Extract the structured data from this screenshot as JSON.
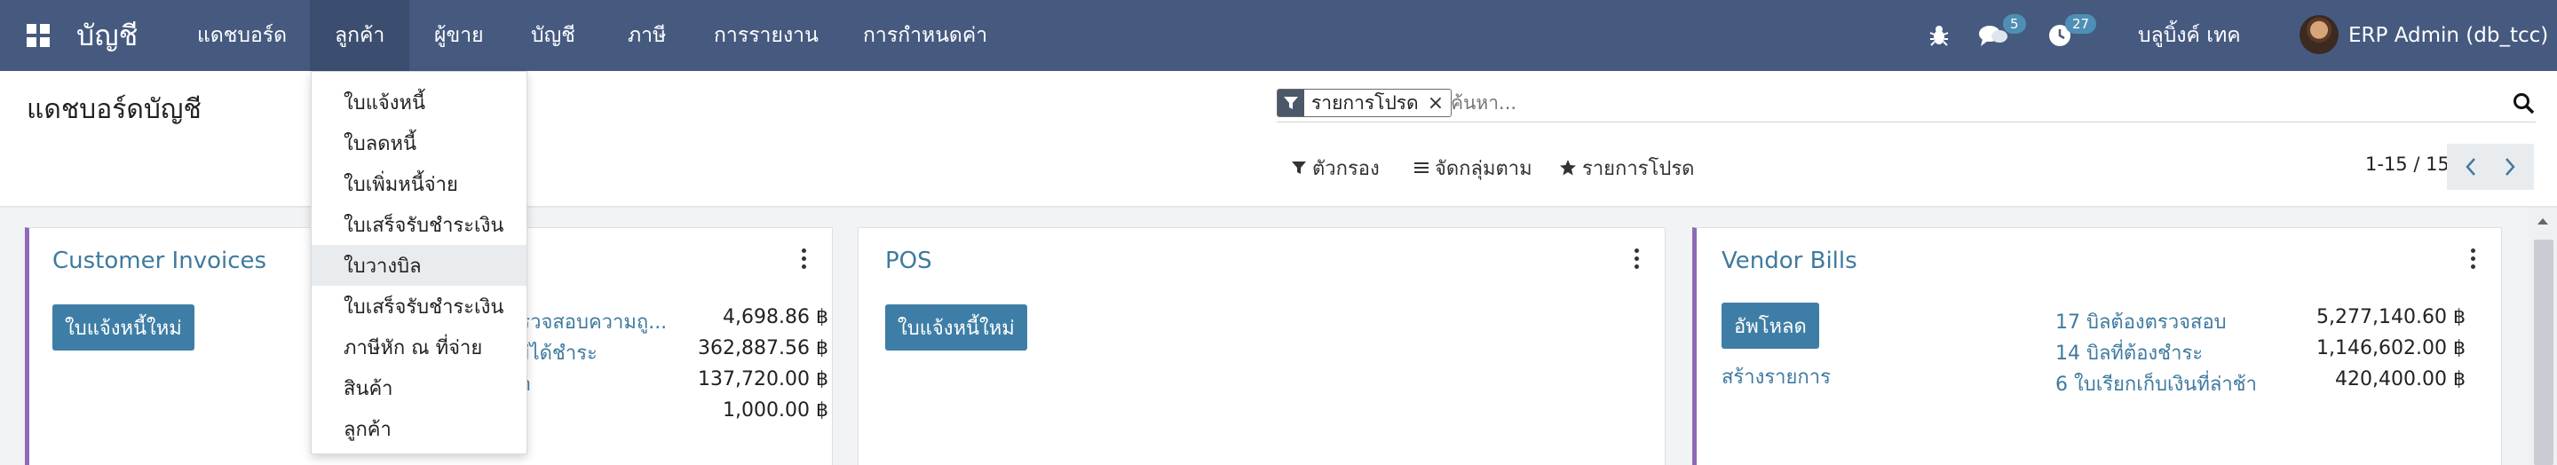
{
  "navbar": {
    "brand": "บัญชี",
    "menus": [
      "แดชบอร์ด",
      "ลูกค้า",
      "ผู้ขาย",
      "บัญชี",
      "ภาษี",
      "การรายงาน",
      "การกำหนดค่า"
    ],
    "active_menu": "ลูกค้า",
    "messages_count": "5",
    "activities_count": "27",
    "company": "บลูบิ้งค์ เทค",
    "user": "ERP Admin (db_tcc)"
  },
  "dropdown": {
    "items": [
      "ใบแจ้งหนี้",
      "ใบลดหนี้",
      "ใบเพิ่มหนี้จ่าย",
      "ใบเสร็จรับชำระเงิน",
      "ใบวางบิล",
      "ใบเสร็จรับชำระเงิน",
      "ภาษีหัก ณ ที่จ่าย",
      "สินค้า",
      "ลูกค้า"
    ],
    "hovered": "ใบวางบิล"
  },
  "control_panel": {
    "title": "แดชบอร์ดบัญชี",
    "facet": "รายการโปรด",
    "search_placeholder": "ค้นหา...",
    "filters_label": "ตัวกรอง",
    "group_by_label": "จัดกลุ่มตาม",
    "favorites_label": "รายการโปรด",
    "pager": "1-15 / 15"
  },
  "cards": {
    "customer_invoices": {
      "title": "Customer Invoices",
      "button": "ใบแจ้งหนี้ใหม่",
      "rows": [
        {
          "label": "ตรวจสอบความถู...",
          "amount": "4,698.86 ฿"
        },
        {
          "label": "ไม่ได้ชำระ",
          "amount": "362,887.56 ฿"
        },
        {
          "label": "ช้า",
          "amount": "137,720.00 ฿"
        },
        {
          "label": "",
          "amount": "1,000.00 ฿"
        }
      ]
    },
    "pos": {
      "title": "POS",
      "button": "ใบแจ้งหนี้ใหม่"
    },
    "vendor_bills": {
      "title": "Vendor Bills",
      "button": "อัพโหลด",
      "create_link": "สร้างรายการ",
      "rows": [
        {
          "label": "17 บิลต้องตรวจสอบ",
          "amount": "5,277,140.60 ฿"
        },
        {
          "label": "14 บิลที่ต้องชำระ",
          "amount": "1,146,602.00 ฿"
        },
        {
          "label": "6 ใบเรียกเก็บเงินที่ล่าช้า",
          "amount": "420,400.00 ฿"
        }
      ]
    }
  }
}
